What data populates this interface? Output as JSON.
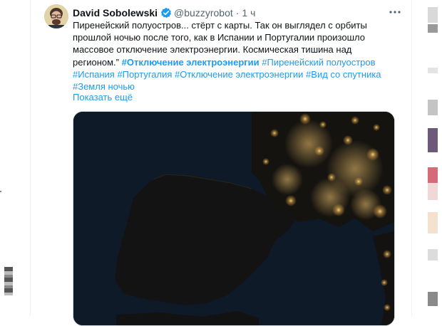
{
  "tweet": {
    "author_name": "David Sobolewski",
    "handle": "@buzzyrobot",
    "separator": "·",
    "time": "1 ч",
    "text_lines": [
      "Пиренейский полуостров... стёрт с карты. Так он выглядел с орбиты",
      "прошлой ночью после того, как в Испании и Португалии произошло",
      "массовое отключение электроэнергии. Космическая тишина над"
    ],
    "text_last_prefix": "регионом.”",
    "hashtags": [
      "#Отключение электроэнергии",
      "#Пиренейский полуостров",
      "#Испания",
      "#Португалия",
      "#Отключение электроэнергии",
      "#Вид со спутника",
      "#Земля ночью"
    ],
    "show_more": "Показать ещё"
  },
  "icons": {
    "verified": "verified-badge-icon",
    "more": "more-horizontal-icon"
  },
  "colors": {
    "link": "#1d9bf0",
    "text": "#0f1419",
    "muted": "#536471",
    "map_sea": "#0e1a28",
    "map_land": "#121212"
  }
}
